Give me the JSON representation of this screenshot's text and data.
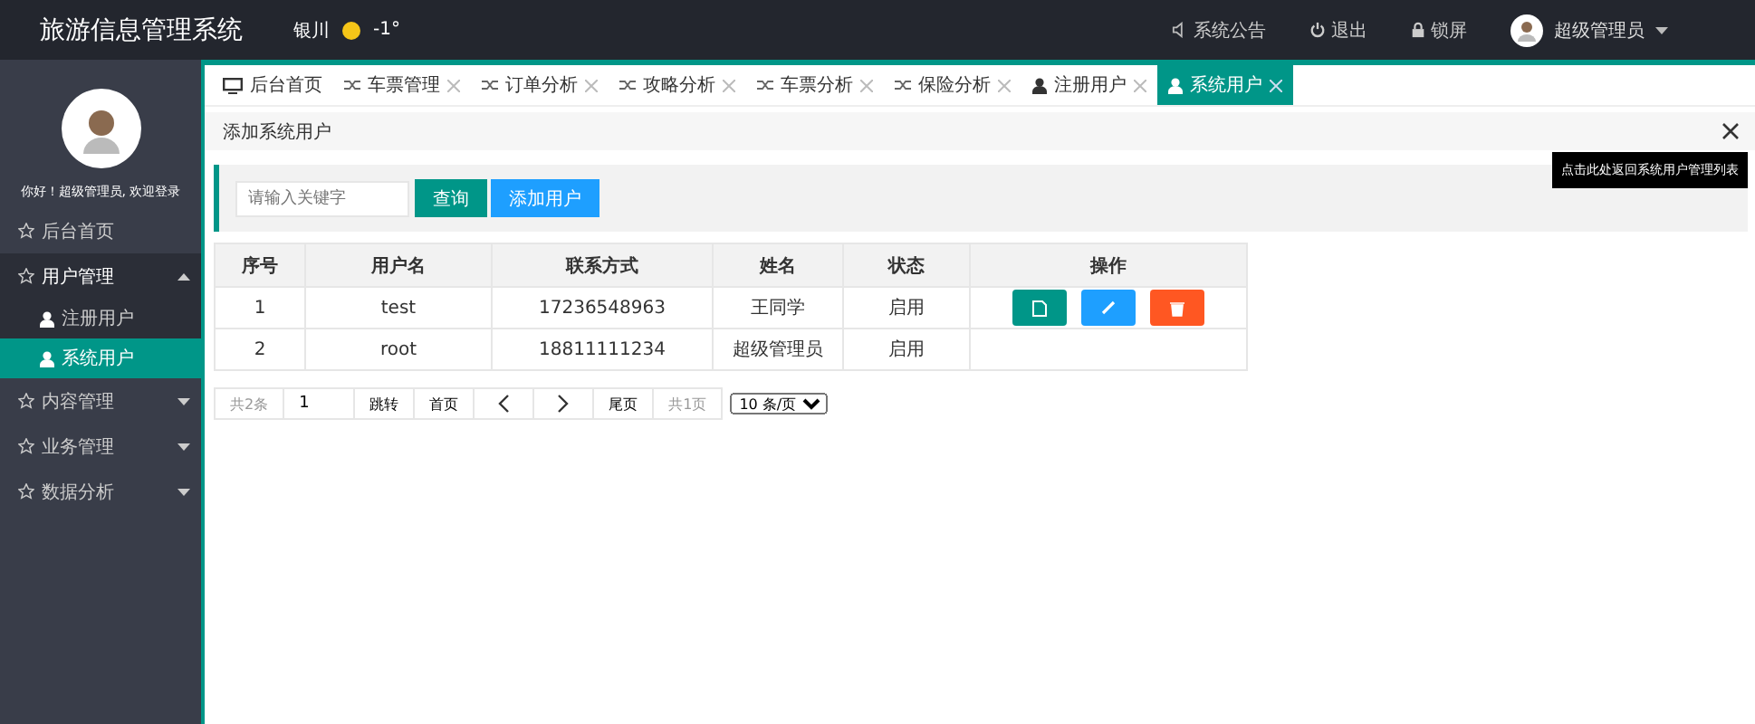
{
  "header": {
    "title": "旅游信息管理系统",
    "weather": {
      "city": "银川",
      "temperature": "-1°"
    },
    "links": [
      {
        "kind": "notice",
        "label": "系统公告"
      },
      {
        "kind": "logout",
        "label": "退出"
      },
      {
        "kind": "lock",
        "label": "锁屏"
      }
    ],
    "user": "超级管理员"
  },
  "sidebar": {
    "greeting": "你好！超级管理员, 欢迎登录",
    "items": [
      {
        "label": "后台首页",
        "selected": false
      },
      {
        "label": "用户管理",
        "expanded": true,
        "selected": false,
        "children": [
          {
            "label": "注册用户",
            "selected": false
          },
          {
            "label": "系统用户",
            "selected": true
          }
        ]
      },
      {
        "label": "内容管理",
        "expanded": false,
        "selected": false
      },
      {
        "label": "业务管理",
        "expanded": false,
        "selected": false
      },
      {
        "label": "数据分析",
        "expanded": false,
        "selected": false
      }
    ]
  },
  "tabs": [
    {
      "kind": "home",
      "label": "后台首页",
      "closable": false,
      "selected": false
    },
    {
      "kind": "chart",
      "label": "车票管理",
      "closable": true,
      "selected": false
    },
    {
      "kind": "chart",
      "label": "订单分析",
      "closable": true,
      "selected": false
    },
    {
      "kind": "chart",
      "label": "攻略分析",
      "closable": true,
      "selected": false
    },
    {
      "kind": "chart",
      "label": "车票分析",
      "closable": true,
      "selected": false
    },
    {
      "kind": "chart",
      "label": "保险分析",
      "closable": true,
      "selected": false
    },
    {
      "kind": "user",
      "label": "注册用户",
      "closable": true,
      "selected": false
    },
    {
      "kind": "user",
      "label": "系统用户",
      "closable": true,
      "selected": true
    }
  ],
  "breadcrumb": "添加系统用户",
  "tooltip": "点击此处返回系统用户管理列表",
  "search": {
    "placeholder": "请输入关键字",
    "buttons": [
      {
        "kind": "query",
        "label": "查询"
      },
      {
        "kind": "add",
        "label": "添加用户"
      }
    ]
  },
  "table": {
    "columns": [
      "序号",
      "用户名",
      "联系方式",
      "姓名",
      "状态",
      "操作"
    ],
    "rows": [
      {
        "cells": [
          "1",
          "test",
          "17236548963",
          "王同学",
          "启用"
        ],
        "actions": [
          {
            "kind": "view"
          },
          {
            "kind": "edit"
          },
          {
            "kind": "delete"
          }
        ]
      },
      {
        "cells": [
          "2",
          "root",
          "18811111234",
          "超级管理员",
          "启用"
        ]
      }
    ]
  },
  "pagination": {
    "total": "共2条",
    "page": "1",
    "jump": "跳转",
    "first": "首页",
    "last": "尾页",
    "pages": "共1页",
    "page_size": "10 条/页"
  }
}
